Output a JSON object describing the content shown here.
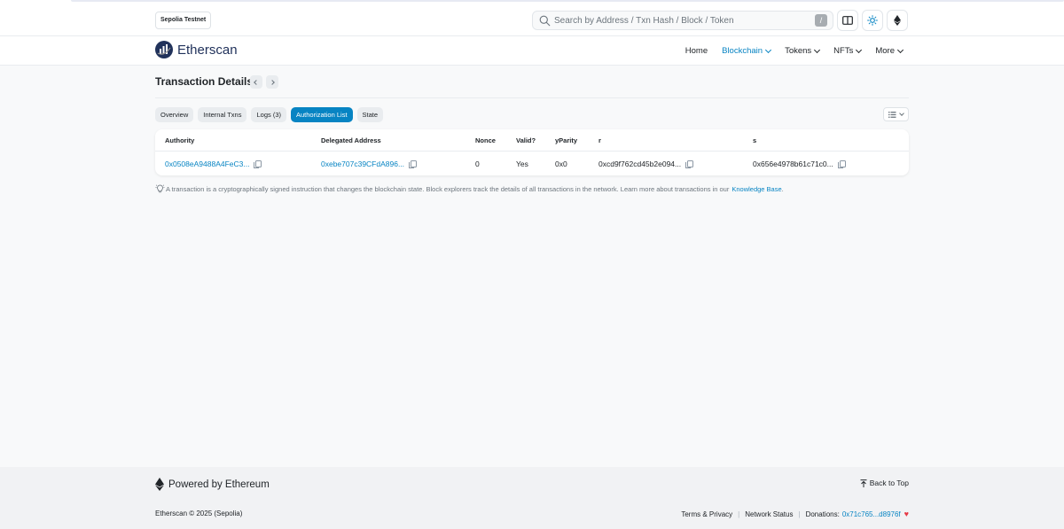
{
  "topbar": {
    "network": "Sepolia Testnet",
    "search_placeholder": "Search by Address / Txn Hash / Block / Token",
    "search_shortcut": "/"
  },
  "navbar": {
    "brand": "Etherscan",
    "items": [
      {
        "label": "Home",
        "dropdown": false,
        "active": false
      },
      {
        "label": "Blockchain",
        "dropdown": true,
        "active": true
      },
      {
        "label": "Tokens",
        "dropdown": true,
        "active": false
      },
      {
        "label": "NFTs",
        "dropdown": true,
        "active": false
      },
      {
        "label": "More",
        "dropdown": true,
        "active": false
      }
    ]
  },
  "page": {
    "title": "Transaction Details",
    "tabs": [
      {
        "label": "Overview",
        "active": false
      },
      {
        "label": "Internal Txns",
        "active": false
      },
      {
        "label": "Logs (3)",
        "active": false
      },
      {
        "label": "Authorization List",
        "active": true
      },
      {
        "label": "State",
        "active": false
      }
    ]
  },
  "table": {
    "headers": [
      "Authority",
      "Delegated Address",
      "Nonce",
      "Valid?",
      "yParity",
      "r",
      "s"
    ],
    "row": {
      "authority": "0x0508eA9488A4FeC3...",
      "delegated": "0xebe707c39CFdA896...",
      "nonce": "0",
      "valid": "Yes",
      "yparity": "0x0",
      "r": "0xcd9f762cd45b2e094...",
      "s": "0x656e4978b61c71c0..."
    }
  },
  "note": {
    "text": "A transaction is a cryptographically signed instruction that changes the blockchain state. Block explorers track the details of all transactions in the network. Learn more about transactions in our",
    "link": "Knowledge Base",
    "suffix": "."
  },
  "footer": {
    "powered": "Powered by Ethereum",
    "back_to_top": "Back to Top",
    "copyright": "Etherscan © 2025 (Sepolia)",
    "terms": "Terms & Privacy",
    "network_status": "Network Status",
    "donations_label": "Donations:",
    "donations_address": "0x71c765...d8976f",
    "heart": "♥"
  },
  "colors": {
    "accent": "#0784c3",
    "brand": "#21325b",
    "valid": "#00a186",
    "heart": "#e63946"
  }
}
